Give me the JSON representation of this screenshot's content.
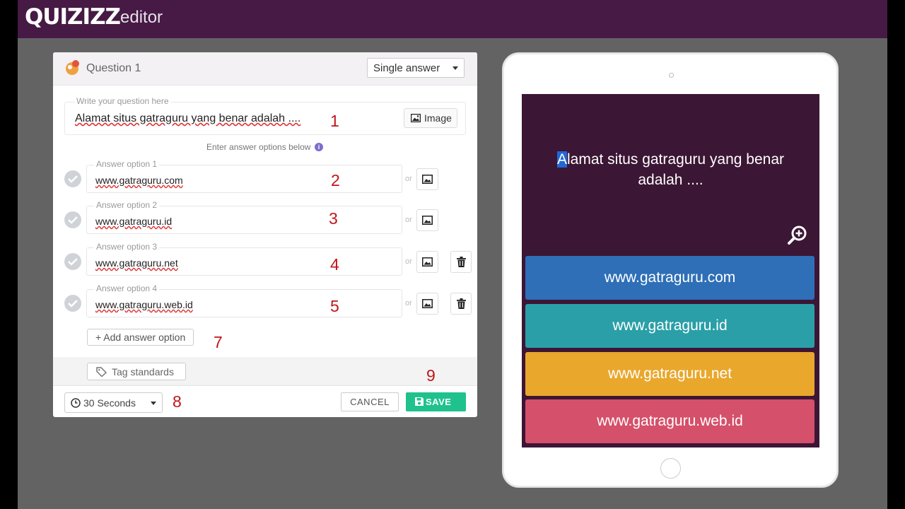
{
  "app": {
    "logo": "QUIZIZZ",
    "section": "editor"
  },
  "editor": {
    "question_title": "Question 1",
    "answer_type": "Single answer",
    "question_label": "Write your question here",
    "question_text": "Alamat situs gatraguru yang benar adalah ....",
    "image_button": "Image",
    "hint": "Enter answer options below",
    "or_text": "or",
    "answers": [
      {
        "label": "Answer option 1",
        "value": "www.gatraguru.com"
      },
      {
        "label": "Answer option 2",
        "value": "www.gatraguru.id"
      },
      {
        "label": "Answer option 3",
        "value": "www.gatraguru.net"
      },
      {
        "label": "Answer option 4",
        "value": "www.gatraguru.web.id"
      }
    ],
    "add_option": "+ Add answer option",
    "tag_standards": "Tag standards",
    "timer": "30 Seconds",
    "cancel": "CANCEL",
    "save": "SAVE"
  },
  "annotations": [
    "1",
    "2",
    "3",
    "4",
    "5",
    "7",
    "8",
    "9"
  ],
  "preview": {
    "question_first_letter": "A",
    "question_rest": "lamat situs gatraguru yang benar adalah ....",
    "options": [
      "www.gatraguru.com",
      "www.gatraguru.id",
      "www.gatraguru.net",
      "www.gatraguru.web.id"
    ],
    "colors": [
      "#2e6fb7",
      "#2a9fa7",
      "#e9a72c",
      "#d5506a"
    ]
  },
  "colors": {
    "topbar": "#461a45",
    "save": "#1fc28c",
    "screen": "#3c1635",
    "annotation": "#c0151a"
  }
}
